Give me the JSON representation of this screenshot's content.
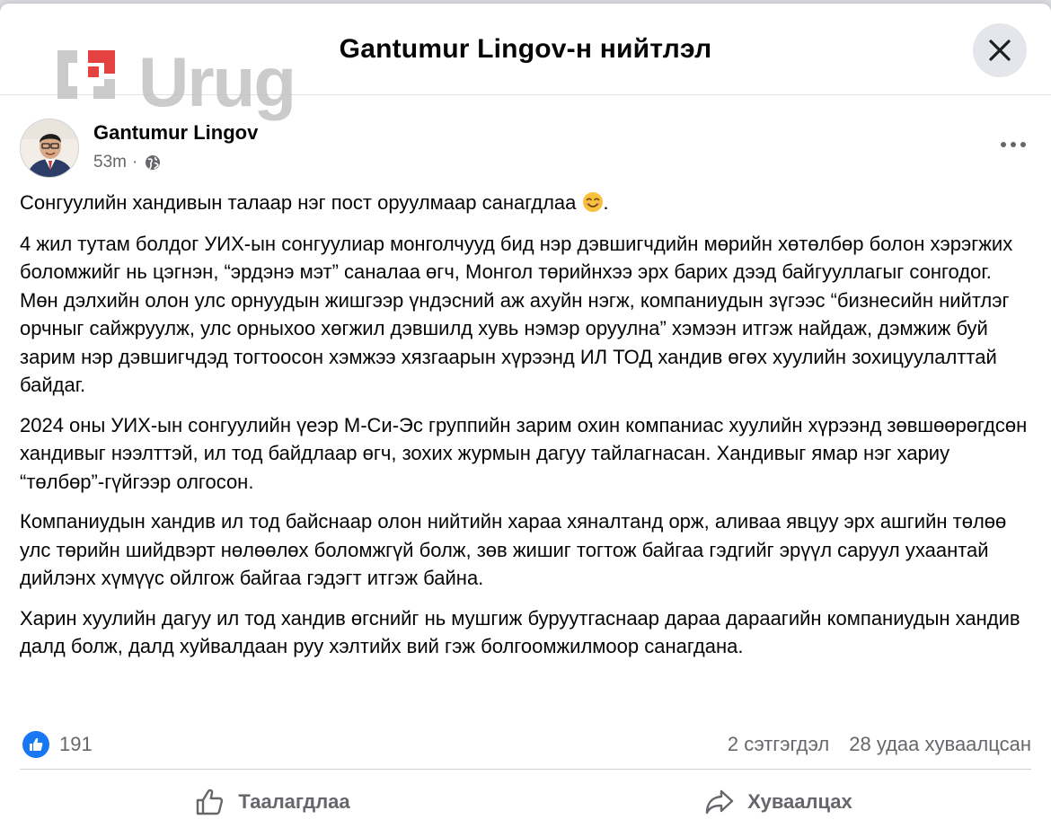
{
  "header": {
    "title": "Gantumur Lingov-н нийтлэл",
    "close_icon": "close-icon"
  },
  "watermark": {
    "text": "Urug"
  },
  "post": {
    "author": "Gantumur Lingov",
    "time": "53m",
    "dot": "·",
    "audience_icon": "globe-icon",
    "paragraphs": [
      "Сонгуулийн хандивын талаар нэг пост оруулмаар санагдлаа",
      "4 жил тутам болдог УИХ-ын сонгуулиар монголчууд бид нэр дэвшигчдийн мөрийн хөтөлбөр болон хэрэгжих боломжийг нь цэгнэн, “эрдэнэ мэт” саналаа өгч, Монгол төрийнхээ эрх барих дээд байгууллагыг сонгодог. Мөн дэлхийн олон улс орнуудын жишгээр үндэсний аж ахуйн нэгж, компаниудын зүгээс “бизнесийн нийтлэг орчныг сайжруулж, улс орныхоо хөгжил дэвшилд хувь нэмэр оруулна” хэмээн итгэж найдаж, дэмжиж буй зарим нэр дэвшигчдэд тогтоосон хэмжээ хязгаарын хүрээнд ИЛ ТОД хандив өгөх хуулийн зохицуулалттай байдаг.",
      "2024 оны УИХ-ын сонгуулийн үеэр М-Си-Эс группийн зарим охин компаниас хуулийн хүрээнд зөвшөөрөгдсөн хандивыг нээлттэй, ил тод байдлаар өгч, зохих журмын дагуу тайлагнасан. Хандивыг ямар нэг хариу “төлбөр”-гүйгээр олгосон.",
      "Компаниудын хандив ил тод байснаар олон нийтийн хараа хяналтанд орж, аливаа явцуу эрх ашгийн төлөө улс төрийн шийдвэрт нөлөөлөх боломжгүй болж, зөв жишиг тогтож байгаа гэдгийг эрүүл саруул ухаантай дийлэнх хүмүүс ойлгож байгаа гэдэгт итгэж байна.",
      "Харин хуулийн дагуу ил тод хандив өгснийг нь мушгиж буруутгаснаар дараа дараагийн компаниудын хандив далд болж, далд хуйвалдаан руу хэлтийх вий гэж болгоомжилмоор санагдана."
    ],
    "first_paragraph_suffix": ".",
    "emoji_icon": "smiling-face-icon"
  },
  "reactions": {
    "like_count": "191",
    "comments": "2 сэтгэгдэл",
    "shares": "28 удаа хуваалцсан"
  },
  "actions": {
    "like_label": "Таалагдлаа",
    "share_label": "Хуваалцах"
  },
  "colors": {
    "accent": "#1877f2",
    "secondary_text": "#65676b",
    "close_bg": "#e4e6eb",
    "watermark_red": "#e02020"
  }
}
